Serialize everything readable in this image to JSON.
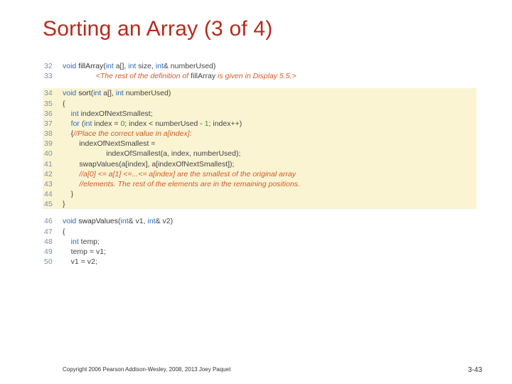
{
  "title": "Sorting an Array (3 of 4)",
  "sections": [
    {
      "highlight": false,
      "lines": [
        {
          "n": "32",
          "tokens": [
            {
              "t": "kw",
              "v": "void "
            },
            {
              "t": "fn",
              "v": "fillArray"
            },
            {
              "t": "pun",
              "v": "("
            },
            {
              "t": "kw",
              "v": "int"
            },
            {
              "t": "id",
              "v": " a[]"
            },
            {
              "t": "pun",
              "v": ", "
            },
            {
              "t": "kw",
              "v": "int"
            },
            {
              "t": "id",
              "v": " size"
            },
            {
              "t": "pun",
              "v": ", "
            },
            {
              "t": "kw",
              "v": "int"
            },
            {
              "t": "id",
              "v": "& numberUsed"
            },
            {
              "t": "pun",
              "v": ")"
            }
          ]
        },
        {
          "n": "33",
          "tokens": [
            {
              "t": "id",
              "v": "                "
            },
            {
              "t": "note",
              "v": "<The rest of the definition of "
            },
            {
              "t": "id",
              "v": "fillArray"
            },
            {
              "t": "note",
              "v": " is given in Display 5.5.>"
            }
          ]
        }
      ]
    },
    {
      "highlight": true,
      "lines": [
        {
          "n": "34",
          "tokens": [
            {
              "t": "kw",
              "v": "void "
            },
            {
              "t": "fn",
              "v": "sort"
            },
            {
              "t": "pun",
              "v": "("
            },
            {
              "t": "kw",
              "v": "int"
            },
            {
              "t": "id",
              "v": " a[]"
            },
            {
              "t": "pun",
              "v": ", "
            },
            {
              "t": "kw",
              "v": "int"
            },
            {
              "t": "id",
              "v": " numberUsed"
            },
            {
              "t": "pun",
              "v": ")"
            }
          ]
        },
        {
          "n": "35",
          "tokens": [
            {
              "t": "pun",
              "v": "{"
            }
          ]
        },
        {
          "n": "36",
          "tokens": [
            {
              "t": "id",
              "v": "    "
            },
            {
              "t": "kw",
              "v": "int"
            },
            {
              "t": "id",
              "v": " indexOfNextSmallest"
            },
            {
              "t": "pun",
              "v": ";"
            }
          ]
        },
        {
          "n": "37",
          "tokens": [
            {
              "t": "id",
              "v": "    "
            },
            {
              "t": "kw",
              "v": "for "
            },
            {
              "t": "pun",
              "v": "("
            },
            {
              "t": "kw",
              "v": "int"
            },
            {
              "t": "id",
              "v": " index "
            },
            {
              "t": "pun",
              "v": "= "
            },
            {
              "t": "num",
              "v": "0"
            },
            {
              "t": "pun",
              "v": "; "
            },
            {
              "t": "id",
              "v": "index "
            },
            {
              "t": "pun",
              "v": "< "
            },
            {
              "t": "id",
              "v": "numberUsed "
            },
            {
              "t": "pun",
              "v": "- "
            },
            {
              "t": "num",
              "v": "1"
            },
            {
              "t": "pun",
              "v": "; "
            },
            {
              "t": "id",
              "v": "index"
            },
            {
              "t": "pun",
              "v": "++)"
            }
          ]
        },
        {
          "n": "38",
          "tokens": [
            {
              "t": "id",
              "v": "    "
            },
            {
              "t": "pun",
              "v": "{"
            },
            {
              "t": "cmt",
              "v": "//Place the correct value in a[index]:"
            }
          ]
        },
        {
          "n": "39",
          "tokens": [
            {
              "t": "id",
              "v": "        indexOfNextSmallest "
            },
            {
              "t": "pun",
              "v": "="
            }
          ]
        },
        {
          "n": "40",
          "tokens": [
            {
              "t": "id",
              "v": "                     indexOfSmallest"
            },
            {
              "t": "pun",
              "v": "("
            },
            {
              "t": "id",
              "v": "a"
            },
            {
              "t": "pun",
              "v": ", "
            },
            {
              "t": "id",
              "v": "index"
            },
            {
              "t": "pun",
              "v": ", "
            },
            {
              "t": "id",
              "v": "numberUsed"
            },
            {
              "t": "pun",
              "v": ");"
            }
          ]
        },
        {
          "n": "41",
          "tokens": [
            {
              "t": "id",
              "v": "        swapValues"
            },
            {
              "t": "pun",
              "v": "("
            },
            {
              "t": "id",
              "v": "a"
            },
            {
              "t": "pun",
              "v": "["
            },
            {
              "t": "id",
              "v": "index"
            },
            {
              "t": "pun",
              "v": "], "
            },
            {
              "t": "id",
              "v": "a"
            },
            {
              "t": "pun",
              "v": "["
            },
            {
              "t": "id",
              "v": "indexOfNextSmallest"
            },
            {
              "t": "pun",
              "v": "]);"
            }
          ]
        },
        {
          "n": "42",
          "tokens": [
            {
              "t": "id",
              "v": "        "
            },
            {
              "t": "cmt",
              "v": "//a[0] <= a[1] <=...<= a[index] are the smallest of the original array"
            }
          ]
        },
        {
          "n": "43",
          "tokens": [
            {
              "t": "id",
              "v": "        "
            },
            {
              "t": "cmt",
              "v": "//elements. The rest of the elements are in the remaining positions."
            }
          ]
        },
        {
          "n": "44",
          "tokens": [
            {
              "t": "id",
              "v": "    "
            },
            {
              "t": "pun",
              "v": "}"
            }
          ]
        },
        {
          "n": "45",
          "tokens": [
            {
              "t": "pun",
              "v": "}"
            }
          ]
        }
      ]
    },
    {
      "highlight": false,
      "lines": [
        {
          "n": "46",
          "tokens": [
            {
              "t": "kw",
              "v": "void "
            },
            {
              "t": "fn",
              "v": "swapValues"
            },
            {
              "t": "pun",
              "v": "("
            },
            {
              "t": "kw",
              "v": "int"
            },
            {
              "t": "id",
              "v": "& v1"
            },
            {
              "t": "pun",
              "v": ", "
            },
            {
              "t": "kw",
              "v": "int"
            },
            {
              "t": "id",
              "v": "& v2"
            },
            {
              "t": "pun",
              "v": ")"
            }
          ]
        },
        {
          "n": "47",
          "tokens": [
            {
              "t": "pun",
              "v": "{"
            }
          ]
        },
        {
          "n": "48",
          "tokens": [
            {
              "t": "id",
              "v": "    "
            },
            {
              "t": "kw",
              "v": "int"
            },
            {
              "t": "id",
              "v": " temp"
            },
            {
              "t": "pun",
              "v": ";"
            }
          ]
        },
        {
          "n": "49",
          "tokens": [
            {
              "t": "id",
              "v": "    temp "
            },
            {
              "t": "pun",
              "v": "= "
            },
            {
              "t": "id",
              "v": "v1"
            },
            {
              "t": "pun",
              "v": ";"
            }
          ]
        },
        {
          "n": "50",
          "tokens": [
            {
              "t": "id",
              "v": "    v1 "
            },
            {
              "t": "pun",
              "v": "= "
            },
            {
              "t": "id",
              "v": "v2"
            },
            {
              "t": "pun",
              "v": ";"
            }
          ]
        }
      ]
    }
  ],
  "footer": {
    "copyright": "Copyright 2006 Pearson Addison-Wesley, 2008, 2013 Joey Paquet",
    "pagenum": "3-43"
  }
}
